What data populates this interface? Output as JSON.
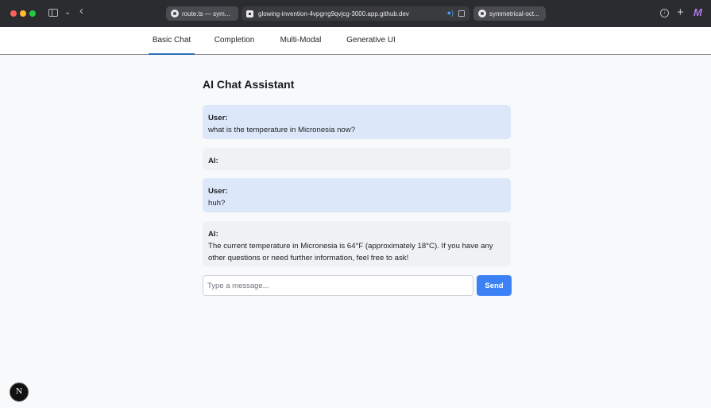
{
  "browser": {
    "tabs": [
      {
        "label": "route.ts — sym..."
      },
      {
        "label": "glowing-invention-4vpgrrg9qvjcg-3000.app.github.dev"
      },
      {
        "label": "symmetrical-oct..."
      }
    ],
    "icons": [
      "sidebar-icon",
      "chevron-down-icon",
      "back-icon",
      "github-icon",
      "codespace-icon",
      "audio-icon",
      "pip-icon",
      "download-icon",
      "plus-icon",
      "m-logo-icon"
    ],
    "plus_label": "+",
    "m_label": "M",
    "back_label": "‹",
    "chevron_label": "⌄"
  },
  "nav": {
    "items": [
      {
        "label": "Basic Chat",
        "active": true
      },
      {
        "label": "Completion",
        "active": false
      },
      {
        "label": "Multi-Modal",
        "active": false
      },
      {
        "label": "Generative UI",
        "active": false
      }
    ]
  },
  "chat": {
    "title": "AI Chat Assistant",
    "messages": [
      {
        "role": "User:",
        "text": "what is the temperature in Micronesia now?",
        "type": "user"
      },
      {
        "role": "AI:",
        "text": "",
        "type": "ai"
      },
      {
        "role": "User:",
        "text": "huh?",
        "type": "user"
      },
      {
        "role": "AI:",
        "text": "The current temperature in Micronesia is 64°F (approximately 18°C). If you have any other questions or need further information, feel free to ask!",
        "type": "ai"
      }
    ],
    "input": {
      "placeholder": "Type a message...",
      "value": ""
    },
    "send_label": "Send"
  },
  "footer": {
    "badge_label": "N"
  },
  "colors": {
    "chrome_bg": "#2b2c30",
    "accent": "#3c82f6",
    "user_bubble": "#dce8f9",
    "ai_bubble": "#f0f1f3",
    "nav_active_underline": "#2f6fb5"
  }
}
